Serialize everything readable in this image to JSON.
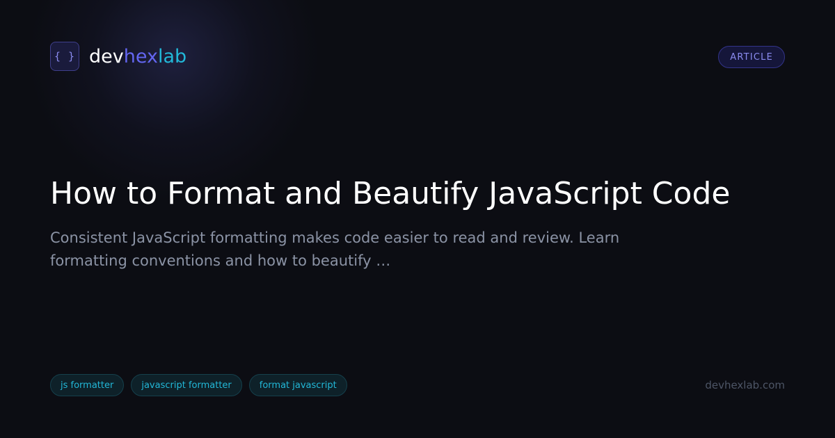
{
  "brand": {
    "logo_glyph": "{ }",
    "name_part1": "dev",
    "name_part2": "hex",
    "name_part3": "lab",
    "colors": {
      "part1": "#ffffff",
      "part2": "#6366f1",
      "part3": "#22b8d8"
    }
  },
  "badge": {
    "label": "ARTICLE"
  },
  "article": {
    "title": "How to Format and Beautify JavaScript Code",
    "description": "Consistent JavaScript formatting makes code easier to read and review. Learn formatting conventions and how to beautify …"
  },
  "tags": [
    "js formatter",
    "javascript formatter",
    "format javascript"
  ],
  "footer": {
    "domain": "devhexlab.com"
  },
  "colors": {
    "background": "#0c0d13",
    "accent_indigo": "#6366f1",
    "accent_cyan": "#22b8d8",
    "muted_text": "#8b93a5"
  }
}
